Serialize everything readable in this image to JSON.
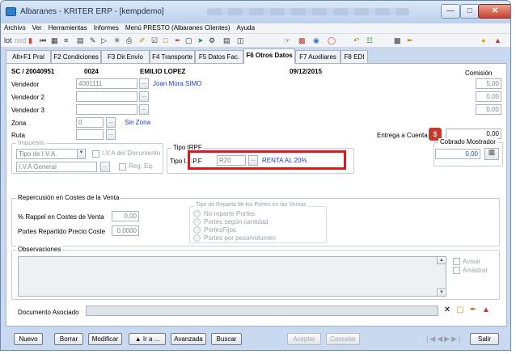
{
  "window": {
    "title": "Albaranes - KRITER ERP - [kempdemo]"
  },
  "menu": [
    "Archivo",
    "Ver",
    "Herramientas",
    "Informes",
    "Menú PRESTO (Albaranes Clientes)",
    "Ayuda"
  ],
  "toolbar": {
    "lot": "lot",
    "nsd": "nsd"
  },
  "tabs": [
    "Alt+F1 Pral",
    "F2 Condiciones",
    "F3 Dir.Envío",
    "F4 Transporte",
    "F5 Datos Fac.",
    "F6 Otros Datos",
    "F7 Auxiliares",
    "F8 EDI"
  ],
  "header": {
    "doc": "SC / 20040951",
    "code": "0024",
    "client": "EMILIO LOPEZ",
    "date": "09/12/2015",
    "comision_label": "Comisión"
  },
  "vendedores": [
    {
      "label": "Vendedor",
      "code": "4001111",
      "name": "Joan Mora SIMO",
      "comision": "5,00"
    },
    {
      "label": "Vendedor 2",
      "code": "",
      "name": "",
      "comision": "0,00"
    },
    {
      "label": "Vendedor 3",
      "code": "",
      "name": "",
      "comision": "0,00"
    }
  ],
  "zona": {
    "label": "Zona",
    "code": "0",
    "name": "Sin Zona"
  },
  "ruta": {
    "label": "Ruta"
  },
  "entrega": {
    "label": "Entrega a Cuenta",
    "value": "0,00"
  },
  "cobrado": {
    "label": "Cobrado Mostrador",
    "value": "0,00"
  },
  "impuesto": {
    "title": "Impuesto",
    "tipo_iva": "Tipo de I.V.A.",
    "iva_documento": "I.V.A del Documento",
    "iva_general": "I.V.A General",
    "reg_eq": "Reg. Eq."
  },
  "irpf": {
    "title": "Tipo IRPF",
    "tipo_label": "Tipo I.",
    "tipo_value": ".P.F",
    "code": "R20",
    "name": "RENTA AL 20%"
  },
  "repercusion": {
    "title": "Repercusión en Costes de la Venta",
    "rappel_label": "% Rappel en Costes de Venta",
    "rappel_value": "0,00",
    "portes_label": "Portes Repartido Precio Coste",
    "portes_value": "0,0000"
  },
  "reparto": {
    "title": "Tipo de Reparto de los Portes en las Ventas",
    "options": [
      "No reparte Portes",
      "Portes según cantidad",
      "PortesFijos",
      "Portes por peso/volumen"
    ]
  },
  "observaciones": {
    "title": "Observaciones",
    "avisar": "Avisar",
    "arrastrar": "Arrastrar"
  },
  "documento": {
    "label": "Documento Asociado"
  },
  "buttons": {
    "nuevo": "Nuevo",
    "borrar": "Borrar",
    "modificar": "Modificar",
    "ira": "Ir a ...",
    "avanzada": "Avanzada",
    "buscar": "Buscar",
    "aceptar": "Aceptar",
    "cancelar": "Cancelar",
    "salir": "Salir"
  }
}
